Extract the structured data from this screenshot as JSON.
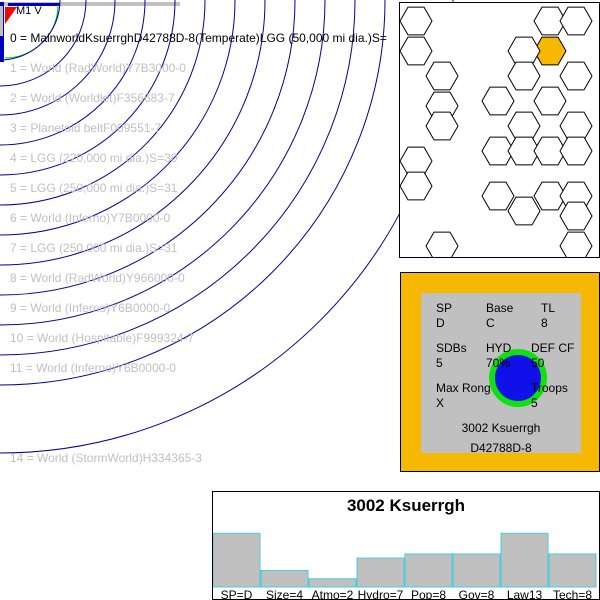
{
  "header": {
    "label": "M1 V"
  },
  "colors": {
    "orbit": "#0000a0",
    "inner_orbit": "#00c000",
    "star": "#ff0000",
    "hex_highlight": "#f6b800",
    "card_border": "#f6b800",
    "card_inner": "#c0c0c0",
    "world_ring": "#10e010",
    "world_core": "#1010e8",
    "bar_fill": "#c0c0c0",
    "bar_stroke": "#40d0e0"
  },
  "orbits": [
    {
      "label": "0 = MainworldKsuerrghD42788D-8(Temperate)LGG (50,000 mi dia.)S=",
      "main": true
    },
    {
      "label": "1 = World  (RadWorld)Y7B3000-0"
    },
    {
      "label": "2 = World  (Worldlet)F356683-7"
    },
    {
      "label": "3 = Planetoid beltF009551-7"
    },
    {
      "label": "4 = LGG (220,000 mi dia.)S=30"
    },
    {
      "label": "5 = LGG (250,000 mi dia.)S=31"
    },
    {
      "label": "6 = World  (Inferno)Y7B0000-0"
    },
    {
      "label": "7 = LGG (250,000 mi dia.)S=31"
    },
    {
      "label": "8 = World  (RadWorld)Y966000-0"
    },
    {
      "label": "9 = World  (Inferno)Y6B0000-0"
    },
    {
      "label": "10 = World  (Hospitable)F999324-7"
    },
    {
      "label": "11 = World  (Inferno)Y6B0000-0"
    },
    {
      "label": "14 = World  (StormWorld)H334365-3"
    }
  ],
  "world_card": {
    "sp_label": "SP",
    "sp_value": "D",
    "base_label": "Base",
    "base_value": "C",
    "tl_label": "TL",
    "tl_value": "8",
    "sdbs_label": "SDBs",
    "sdbs_value": "5",
    "hyd_label": "HYD",
    "hyd_value": "70%",
    "def_label": "DEF CF",
    "def_value": "50",
    "maxrong_label": "Max Rong",
    "maxrong_value": "X",
    "troops_label": "Troops",
    "troops_value": "5",
    "name": "3002 Ksuerrgh",
    "uwp": "D42788D-8"
  },
  "chart_data": {
    "type": "bar",
    "title": "3002 Ksuerrgh",
    "categories": [
      "SP=D",
      "Size=4",
      "Atmo=2",
      "Hydro=7",
      "Pop=8",
      "Gov=8",
      "Law13",
      "Tech=8"
    ],
    "values": [
      13,
      4,
      2,
      7,
      8,
      8,
      13,
      8
    ],
    "ylim": [
      0,
      15
    ]
  }
}
